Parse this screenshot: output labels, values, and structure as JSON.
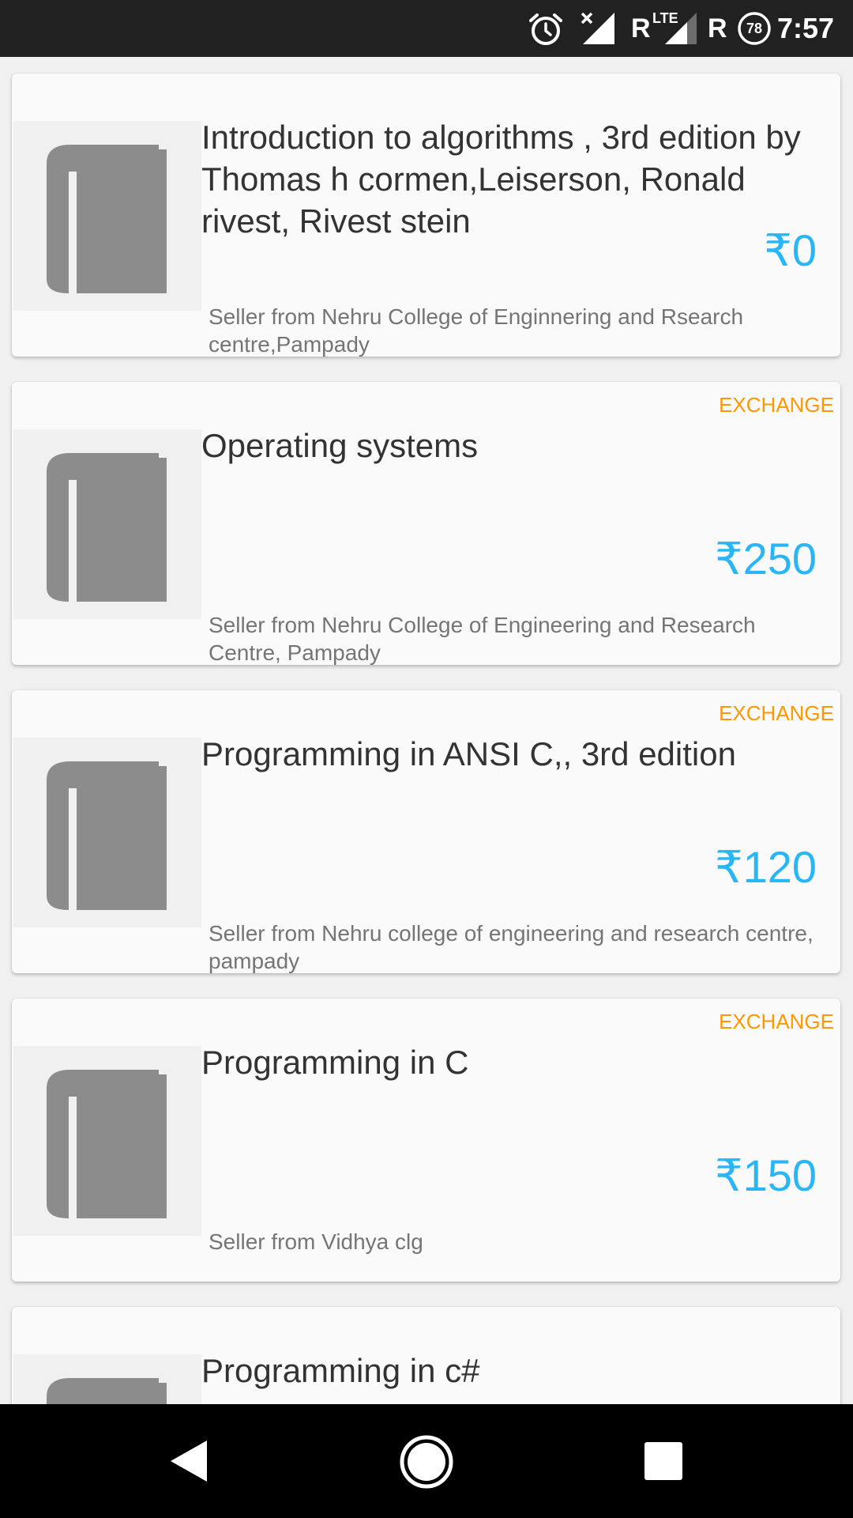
{
  "status_bar": {
    "time": "7:57",
    "signal_letter_1": "R",
    "network_type": "LTE",
    "signal_letter_2": "R",
    "battery_level": "78",
    "icons": [
      "alarm-icon",
      "no-signal-icon",
      "lte-signal-icon",
      "battery-icon"
    ]
  },
  "listings": [
    {
      "title": "Introduction to algorithms , 3rd edition by Thomas h cormen,Leiserson, Ronald rivest, Rivest stein",
      "price": "₹0",
      "seller": "Seller from Nehru College of Enginnering and Rsearch centre,Pampady",
      "tag": ""
    },
    {
      "title": "Operating systems",
      "price": "₹250",
      "seller": "Seller from Nehru College of Engineering and Research Centre, Pampady",
      "tag": "EXCHANGE"
    },
    {
      "title": "Programming in ANSI C,, 3rd edition",
      "price": "₹120",
      "seller": "Seller from Nehru college of engineering and research centre, pampady",
      "tag": "EXCHANGE"
    },
    {
      "title": "Programming in C",
      "price": "₹150",
      "seller": "Seller from Vidhya clg",
      "tag": "EXCHANGE"
    },
    {
      "title": "Programming in c#",
      "price": "",
      "seller": "",
      "tag": ""
    }
  ],
  "colors": {
    "status_bar_bg": "#212121",
    "price": "#29b6f6",
    "exchange_tag": "#ff9800",
    "title": "#333333",
    "seller": "#757575",
    "book_icon": "#8c8c8c",
    "card_bg": "#fafafa"
  },
  "nav_bar": {
    "icons": [
      "back-icon",
      "home-icon",
      "recents-icon"
    ]
  }
}
